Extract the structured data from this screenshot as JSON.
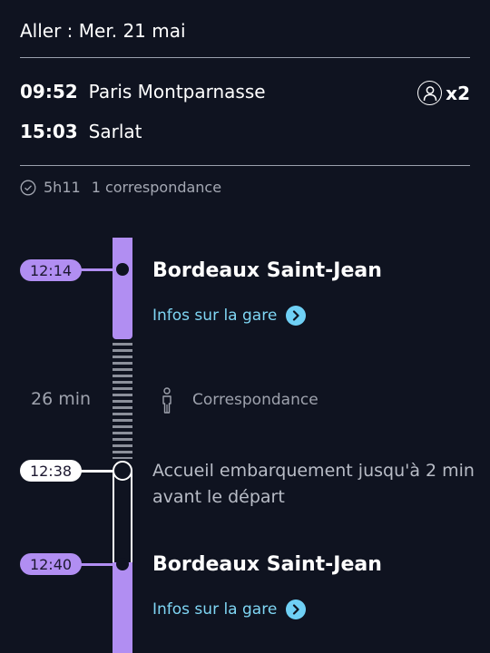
{
  "header": {
    "date_title": "Aller : Mer. 21 mai"
  },
  "journey": {
    "departure_time": "09:52",
    "departure_station": "Paris Montparnasse",
    "arrival_time": "15:03",
    "arrival_station": "Sarlat",
    "passengers": "x2",
    "passenger_icon": "person-circle-icon"
  },
  "summary": {
    "duration": "5h11",
    "connections": "1 correspondance",
    "icon": "clock-icon"
  },
  "timeline": {
    "arrival_stop": {
      "time": "12:14",
      "station": "Bordeaux Saint-Jean",
      "link_label": "Infos sur la gare"
    },
    "connection": {
      "duration": "26 min",
      "label": "Correspondance",
      "icon": "walking-person-icon"
    },
    "boarding": {
      "time": "12:38",
      "note": "Accueil embarquement jusqu'à 2 min avant le départ"
    },
    "departure_stop": {
      "time": "12:40",
      "station": "Bordeaux Saint-Jean",
      "link_label": "Infos sur la gare"
    }
  },
  "colors": {
    "background": "#0f1320",
    "accent_purple": "#b18ef2",
    "link_blue": "#7fd6f4",
    "muted_text": "#9ea2ad"
  }
}
